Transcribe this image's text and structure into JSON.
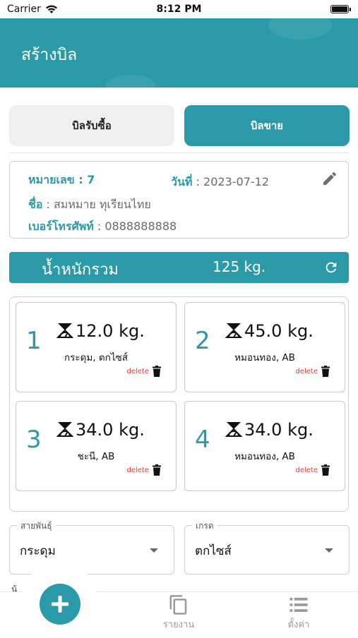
{
  "status_bar": {
    "carrier": "Carrier",
    "time": "8:12 PM"
  },
  "header": {
    "title": "สร้างบิล"
  },
  "tabs": {
    "buy_label": "บิลรับซื้อ",
    "sell_label": "บิลขาย"
  },
  "bill_info": {
    "number_label": "หมายเลข : 7",
    "date_label": "วันที่",
    "date_value": " : 2023-07-12",
    "name_label": "ชื่อ",
    "name_value": " : สมหมาย ทุเรียนไทย",
    "phone_label": "เบอร์โทรศัพท์",
    "phone_value": " : 0888888888"
  },
  "total": {
    "label": "น้ำหนักรวม",
    "value": "125 kg."
  },
  "items": [
    {
      "index": "1",
      "weight": "12.0 kg.",
      "desc": "กระดุม, ตกไซส์",
      "delete_label": "delete"
    },
    {
      "index": "2",
      "weight": "45.0 kg.",
      "desc": "หมอนทอง, AB",
      "delete_label": "delete"
    },
    {
      "index": "3",
      "weight": "34.0 kg.",
      "desc": "ชะนี, AB",
      "delete_label": "delete"
    },
    {
      "index": "4",
      "weight": "34.0 kg.",
      "desc": "หมอนทอง, AB",
      "delete_label": "delete"
    }
  ],
  "form": {
    "variety": {
      "legend": "สายพันธุ์",
      "value": "กระดุม"
    },
    "grade": {
      "legend": "เกรด",
      "value": "ตกไซส์"
    },
    "partial_label": "น้"
  },
  "bottom_nav": {
    "report_label": "รายงาน",
    "settings_label": "ตั้งค่า"
  },
  "colors": {
    "primary": "#2a9aa8",
    "delete": "#e53935"
  },
  "icons": [
    "wifi-icon",
    "battery-icon",
    "edit-icon",
    "refresh-icon",
    "scale-icon",
    "trash-icon",
    "add-icon",
    "copy-icon",
    "list-icon"
  ]
}
